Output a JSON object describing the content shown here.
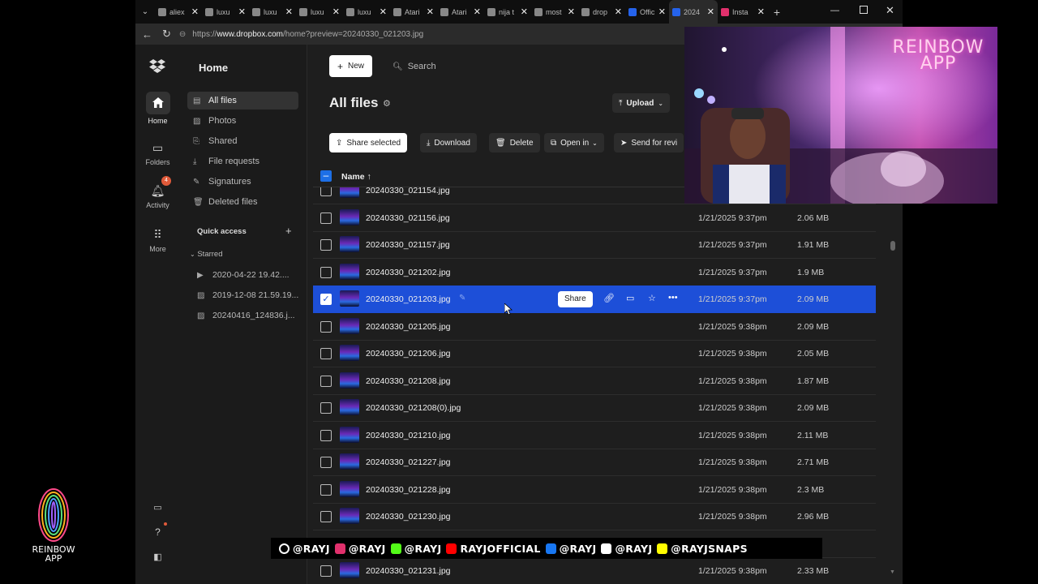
{
  "browser": {
    "tabs": [
      {
        "label": "aliex",
        "color": "#888"
      },
      {
        "label": "luxu",
        "color": "#888"
      },
      {
        "label": "luxu",
        "color": "#888"
      },
      {
        "label": "luxu",
        "color": "#888"
      },
      {
        "label": "luxu",
        "color": "#888"
      },
      {
        "label": "Atari",
        "color": "#888"
      },
      {
        "label": "Atari",
        "color": "#888"
      },
      {
        "label": "nija t",
        "color": "#888"
      },
      {
        "label": "most",
        "color": "#888"
      },
      {
        "label": "drop",
        "color": "#888"
      },
      {
        "label": "Offic",
        "color": "#2563eb"
      },
      {
        "label": "2024",
        "color": "#2563eb"
      },
      {
        "label": "Insta",
        "color": "#e1306c"
      }
    ],
    "url_prefix": "https://",
    "url_host": "www.dropbox.com",
    "url_path": "/home?preview=20240330_021203.jpg"
  },
  "rail": {
    "home": "Home",
    "folders": "Folders",
    "activity": "Activity",
    "activity_badge": "4",
    "more": "More"
  },
  "nav": {
    "title": "Home",
    "items": [
      "All files",
      "Photos",
      "Shared",
      "File requests",
      "Signatures",
      "Deleted files"
    ],
    "quick_access": "Quick access",
    "starred_label": "Starred",
    "starred": [
      "2020-04-22 19.42....",
      "2019-12-08 21.59.19...",
      "20240416_124836.j..."
    ]
  },
  "toolbar": {
    "new_label": "New",
    "search_placeholder": "Search",
    "page_title": "All files",
    "upload_label": "Upload",
    "share_selected": "Share selected",
    "download": "Download",
    "delete": "Delete",
    "open_in": "Open in",
    "send_review": "Send for revi"
  },
  "table": {
    "name_header": "Name",
    "share_label": "Share",
    "rows": [
      {
        "name": "20240330_021154.jpg",
        "modified": "",
        "size": ""
      },
      {
        "name": "20240330_021156.jpg",
        "modified": "1/21/2025 9:37pm",
        "size": "2.06 MB"
      },
      {
        "name": "20240330_021157.jpg",
        "modified": "1/21/2025 9:37pm",
        "size": "1.91 MB"
      },
      {
        "name": "20240330_021202.jpg",
        "modified": "1/21/2025 9:37pm",
        "size": "1.9 MB"
      },
      {
        "name": "20240330_021203.jpg",
        "modified": "1/21/2025 9:37pm",
        "size": "2.09 MB",
        "selected": true
      },
      {
        "name": "20240330_021205.jpg",
        "modified": "1/21/2025 9:38pm",
        "size": "2.09 MB"
      },
      {
        "name": "20240330_021206.jpg",
        "modified": "1/21/2025 9:38pm",
        "size": "2.05 MB"
      },
      {
        "name": "20240330_021208.jpg",
        "modified": "1/21/2025 9:38pm",
        "size": "1.87 MB"
      },
      {
        "name": "20240330_021208(0).jpg",
        "modified": "1/21/2025 9:38pm",
        "size": "2.09 MB"
      },
      {
        "name": "20240330_021210.jpg",
        "modified": "1/21/2025 9:38pm",
        "size": "2.11 MB"
      },
      {
        "name": "20240330_021227.jpg",
        "modified": "1/21/2025 9:38pm",
        "size": "2.71 MB"
      },
      {
        "name": "20240330_021228.jpg",
        "modified": "1/21/2025 9:38pm",
        "size": "2.3 MB"
      },
      {
        "name": "20240330_021230.jpg",
        "modified": "1/21/2025 9:38pm",
        "size": "2.96 MB"
      },
      {
        "name": "",
        "modified": "",
        "size": "B"
      },
      {
        "name": "20240330_021231.jpg",
        "modified": "1/21/2025 9:38pm",
        "size": "2.33 MB"
      }
    ]
  },
  "overlay": {
    "cam_logo": "REINBOW APP",
    "corner_logo_line1": "REINBOW",
    "corner_logo_line2": "APP",
    "socials": [
      {
        "text": "@RAYJ",
        "color": "#ffffff"
      },
      {
        "text": "@RAYJ",
        "color": "#e1306c"
      },
      {
        "text": "@RAYJ",
        "color": "#53fc18"
      },
      {
        "text": "RAYJOFFICIAL",
        "color": "#ff0000"
      },
      {
        "text": "@RAYJ",
        "color": "#1877f2"
      },
      {
        "text": "@RAYJ",
        "color": "#ffffff"
      },
      {
        "text": "@RAYJSNAPS",
        "color": "#fffc00"
      }
    ]
  },
  "colors": {
    "accent": "#1d4fd8",
    "bg": "#1e1e1e"
  }
}
